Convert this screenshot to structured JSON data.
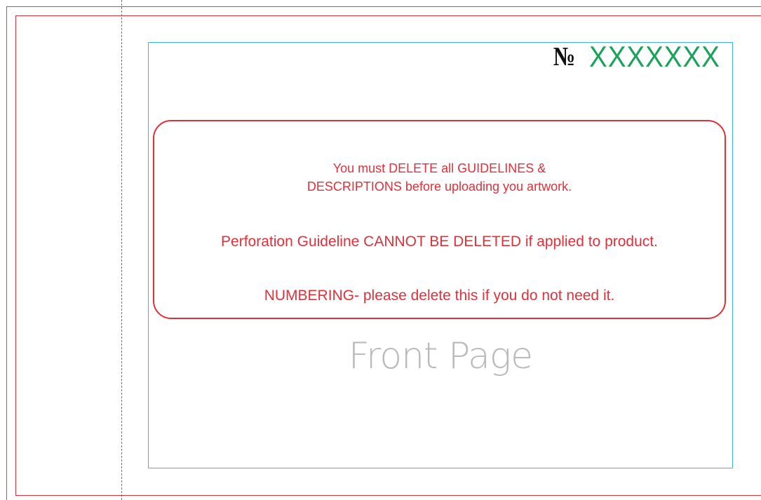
{
  "numbering": {
    "prefix": "№",
    "value": "XXXXXXX"
  },
  "notice": {
    "line1": "You must DELETE all GUIDELINES &",
    "line2": "DESCRIPTIONS before uploading you artwork.",
    "line3": "Perforation Guideline CANNOT BE DELETED if applied to product.",
    "line4": "NUMBERING- please delete this if you do not need it."
  },
  "page_label": "Front Page",
  "colors": {
    "bleed": "#1aa35a",
    "trim": "#e0303a",
    "safe": "#3cb4e6",
    "perforation": "#1aa35a",
    "notice_text": "#e0303a",
    "numbering_value": "#1aa35a",
    "page_label": "#b8babd"
  }
}
